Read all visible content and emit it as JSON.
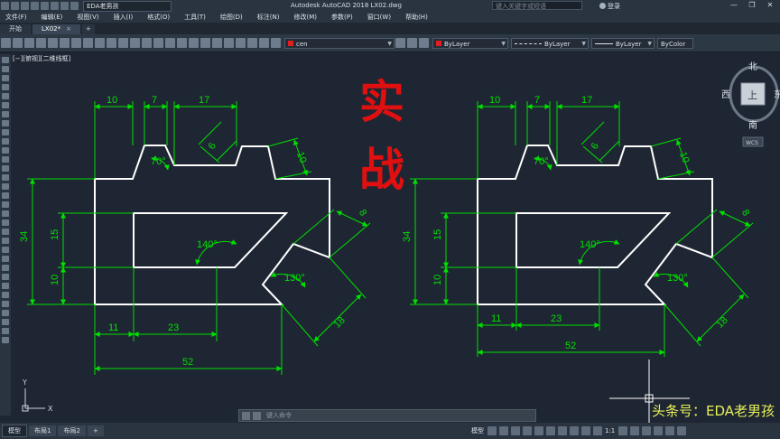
{
  "titlebar": {
    "workspace": "EDA老男孩",
    "app_title": "Autodesk AutoCAD 2018    LX02.dwg",
    "search_placeholder": "键入关键字或短语",
    "user_label": "登录",
    "win_min": "—",
    "win_max": "❐",
    "win_close": "✕"
  },
  "menu": [
    "文件(F)",
    "编辑(E)",
    "视图(V)",
    "插入(I)",
    "格式(O)",
    "工具(T)",
    "绘图(D)",
    "标注(N)",
    "修改(M)",
    "参数(P)",
    "窗口(W)",
    "帮助(H)"
  ],
  "tabs": [
    {
      "label": "开始",
      "close": ""
    },
    {
      "label": "LX02*",
      "close": "×"
    }
  ],
  "tab_add": "+",
  "properties": {
    "layer": "cen",
    "color": "ByLayer",
    "linetype": "ByLayer",
    "lineweight": "ByLayer",
    "plotstyle": "ByColor"
  },
  "viewport_label": "[−][俯视][二维线框]",
  "viewcube": {
    "north": "北",
    "south": "南",
    "west": "西",
    "east": "东",
    "face": "上",
    "wcs": "WCS"
  },
  "overlay_text": {
    "char1": "实",
    "char2": "战"
  },
  "ucs": {
    "x": "X",
    "y": "Y"
  },
  "command_placeholder": "键入命令",
  "layout_tabs": [
    "模型",
    "布局1",
    "布局2"
  ],
  "layout_add": "+",
  "status": {
    "model": "模型",
    "scale": "1:1"
  },
  "watermark": "头条号：EDA老男孩",
  "colors": {
    "dim": "#00e000",
    "outline": "#ffffff",
    "accent": "#e01010",
    "watermark": "#e8f05a"
  },
  "drawing_dims": {
    "top_widths": [
      "10",
      "7",
      "17"
    ],
    "angle_top": "70°",
    "slot_width": "6",
    "right_top": "10",
    "notch_width": "8",
    "inner_angle": "140°",
    "notch_angle": "130°",
    "overall_height": "34",
    "inner_height": "15",
    "bottom_height": "10",
    "bottom_offset": "11",
    "inner_width": "23",
    "overall_width": "52",
    "slant_length": "18"
  }
}
